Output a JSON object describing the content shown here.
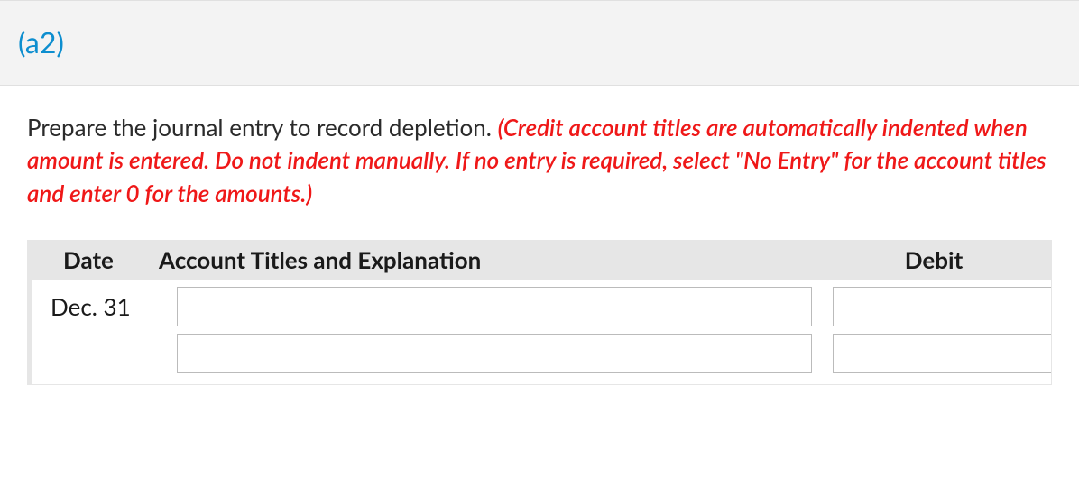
{
  "header": {
    "section_label": "(a2)"
  },
  "instruction": {
    "lead": "Prepare the journal entry to record depletion. ",
    "note": "(Credit account titles are automatically indented when amount is entered. Do not indent manually. If no entry is required, select \"No Entry\" for the account titles and enter 0 for the amounts.)"
  },
  "table": {
    "headers": {
      "date": "Date",
      "account": "Account Titles and Explanation",
      "debit": "Debit"
    },
    "rows": [
      {
        "date": "Dec. 31",
        "account": "",
        "debit": ""
      },
      {
        "date": "",
        "account": "",
        "debit": ""
      }
    ]
  }
}
